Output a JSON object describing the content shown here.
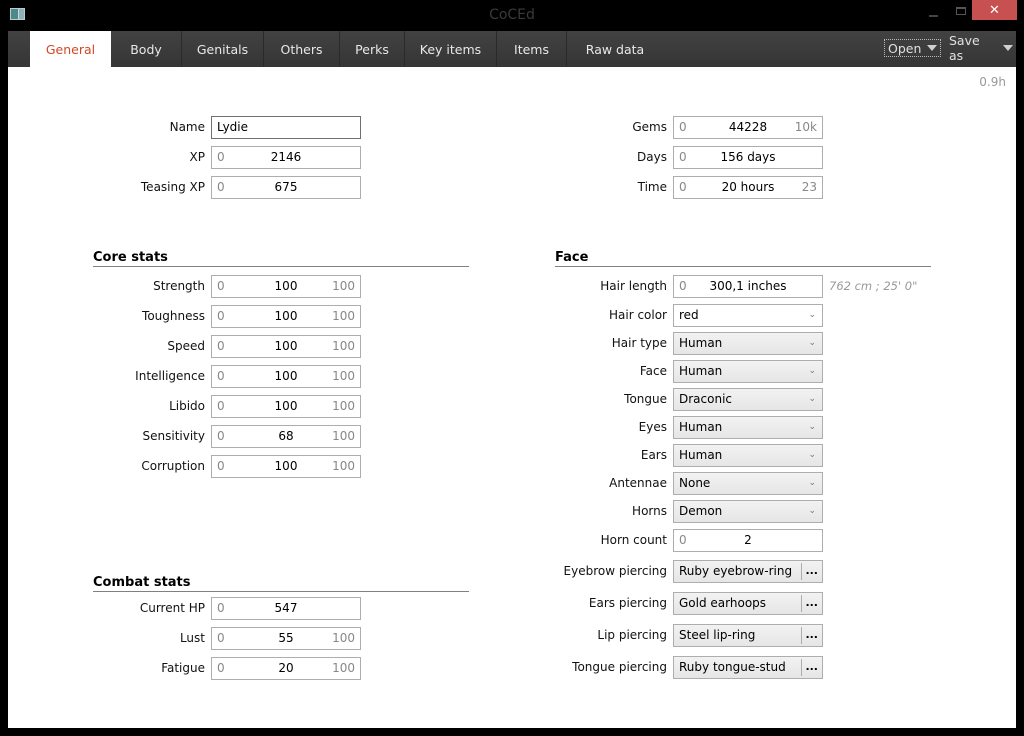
{
  "window": {
    "title": "CoCEd",
    "controls": {
      "minimize": "–",
      "maximize": "□",
      "close": "✕"
    }
  },
  "tabs": [
    {
      "label": "General",
      "active": true
    },
    {
      "label": "Body",
      "active": false
    },
    {
      "label": "Genitals",
      "active": false
    },
    {
      "label": "Others",
      "active": false
    },
    {
      "label": "Perks",
      "active": false
    },
    {
      "label": "Key items",
      "active": false
    },
    {
      "label": "Items",
      "active": false
    },
    {
      "label": "Raw data",
      "active": false
    }
  ],
  "menu": {
    "open_label": "Open",
    "save_label": "Save as"
  },
  "version": "0.9h",
  "general": {
    "name": {
      "label": "Name",
      "value": "Lydie"
    },
    "xp": {
      "label": "XP",
      "min": "0",
      "value": "2146",
      "max": ""
    },
    "teasing_xp": {
      "label": "Teasing XP",
      "min": "0",
      "value": "675",
      "max": ""
    },
    "gems": {
      "label": "Gems",
      "min": "0",
      "value": "44228",
      "max": "10k"
    },
    "days": {
      "label": "Days",
      "min": "0",
      "value": "156 days",
      "max": ""
    },
    "time": {
      "label": "Time",
      "min": "0",
      "value": "20 hours",
      "max": "23"
    }
  },
  "core_stats": {
    "title": "Core stats",
    "items": [
      {
        "label": "Strength",
        "min": "0",
        "value": "100",
        "max": "100"
      },
      {
        "label": "Toughness",
        "min": "0",
        "value": "100",
        "max": "100"
      },
      {
        "label": "Speed",
        "min": "0",
        "value": "100",
        "max": "100"
      },
      {
        "label": "Intelligence",
        "min": "0",
        "value": "100",
        "max": "100"
      },
      {
        "label": "Libido",
        "min": "0",
        "value": "100",
        "max": "100"
      },
      {
        "label": "Sensitivity",
        "min": "0",
        "value": "68",
        "max": "100"
      },
      {
        "label": "Corruption",
        "min": "0",
        "value": "100",
        "max": "100"
      }
    ]
  },
  "combat_stats": {
    "title": "Combat stats",
    "items": [
      {
        "label": "Current HP",
        "min": "0",
        "value": "547",
        "max": ""
      },
      {
        "label": "Lust",
        "min": "0",
        "value": "55",
        "max": "100"
      },
      {
        "label": "Fatigue",
        "min": "0",
        "value": "20",
        "max": "100"
      }
    ]
  },
  "face": {
    "title": "Face",
    "hair_length": {
      "label": "Hair length",
      "min": "0",
      "value": "300,1 inches",
      "hint": "762 cm ; 25' 0\""
    },
    "hair_color": {
      "label": "Hair color",
      "value": "red"
    },
    "combos": [
      {
        "label": "Hair type",
        "value": "Human"
      },
      {
        "label": "Face",
        "value": "Human"
      },
      {
        "label": "Tongue",
        "value": "Draconic"
      },
      {
        "label": "Eyes",
        "value": "Human"
      },
      {
        "label": "Ears",
        "value": "Human"
      },
      {
        "label": "Antennae",
        "value": "None"
      },
      {
        "label": "Horns",
        "value": "Demon"
      }
    ],
    "horn_count": {
      "label": "Horn count",
      "min": "0",
      "value": "2"
    },
    "piercings": [
      {
        "label": "Eyebrow piercing",
        "value": "Ruby eyebrow-ring",
        "button": "..."
      },
      {
        "label": "Ears piercing",
        "value": "Gold earhoops",
        "button": "..."
      },
      {
        "label": "Lip piercing",
        "value": "Steel lip-ring",
        "button": "..."
      },
      {
        "label": "Tongue piercing",
        "value": "Ruby tongue-stud",
        "button": "..."
      }
    ]
  }
}
